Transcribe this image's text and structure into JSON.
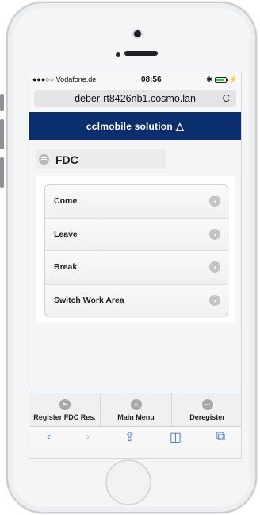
{
  "status_bar": {
    "carrier": "●●●○○ Vodafone.de",
    "wifi": "wifi-icon",
    "time": "08:56",
    "bluetooth": "✱",
    "charge": "⚡"
  },
  "browser": {
    "url": "deber-rt8426nb1.cosmo.lan",
    "reload": "C"
  },
  "brand": {
    "name": "cclmobile solution",
    "logo_glyph": "△",
    "color": "#0b2e6e"
  },
  "page": {
    "title": "FDC"
  },
  "menu_items": [
    {
      "label": "Come"
    },
    {
      "label": "Leave"
    },
    {
      "label": "Break"
    },
    {
      "label": "Switch Work Area"
    }
  ],
  "tabs": [
    {
      "label": "Register FDC Res.",
      "icon": "location-arrow-icon",
      "glyph": "➤"
    },
    {
      "label": "Main Menu",
      "icon": "home-icon",
      "glyph": "⌂"
    },
    {
      "label": "Deregister",
      "icon": "minus-circle-icon",
      "glyph": "—"
    }
  ],
  "safari_toolbar": {
    "back": "‹",
    "forward": "›",
    "share": "⇪",
    "bookmarks": "◫",
    "tabs": "⧉"
  }
}
